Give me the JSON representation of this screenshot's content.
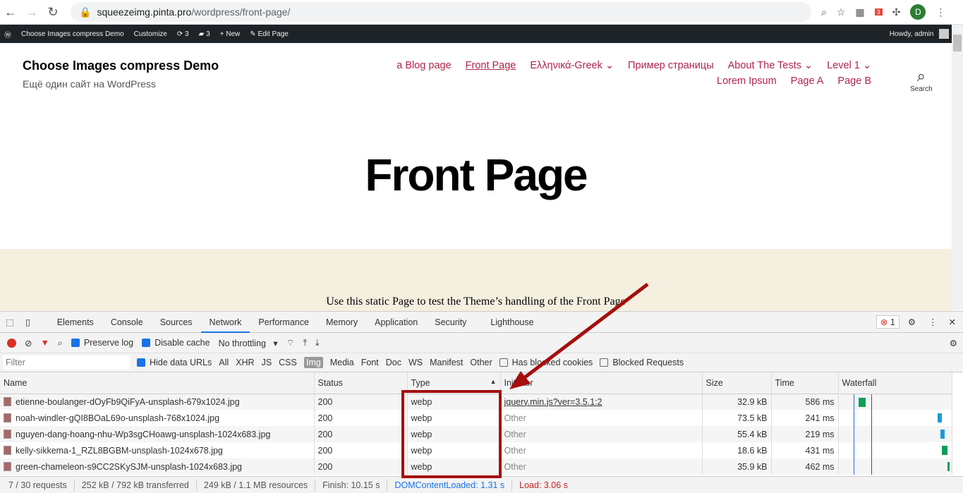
{
  "browser": {
    "url_host": "squeezeimg.pinta.pro",
    "url_path": "/wordpress/front-page/",
    "profile_initial": "D",
    "ext_badge": "3"
  },
  "adminbar": {
    "site": "Choose Images compress Demo",
    "customize": "Customize",
    "updates": "3",
    "comments": "3",
    "new": "New",
    "edit": "Edit Page",
    "howdy": "Howdy, admin"
  },
  "site": {
    "title": "Choose Images compress Demo",
    "tagline": "Ещё один сайт на WordPress",
    "nav": [
      "a Blog page",
      "Front Page",
      "Ελληνικά-Greek ⌄",
      "Пример страницы",
      "About The Tests ⌄",
      "Level 1 ⌄",
      "Lorem Ipsum",
      "Page A",
      "Page B"
    ],
    "search": "Search",
    "heading": "Front Page",
    "intro": "Use this static Page to test the Theme’s handling of the Front Page"
  },
  "devtools": {
    "tabs": [
      "Elements",
      "Console",
      "Sources",
      "Network",
      "Performance",
      "Memory",
      "Application",
      "Security",
      "Lighthouse"
    ],
    "active_tab": "Network",
    "errors": "1",
    "toolbar": {
      "preserve_log": "Preserve log",
      "disable_cache": "Disable cache",
      "throttling": "No throttling"
    },
    "filterbar": {
      "placeholder": "Filter",
      "hide_data_urls": "Hide data URLs",
      "types": [
        "All",
        "XHR",
        "JS",
        "CSS",
        "Img",
        "Media",
        "Font",
        "Doc",
        "WS",
        "Manifest",
        "Other"
      ],
      "selected": "Img",
      "blocked_cookies": "Has blocked cookies",
      "blocked_requests": "Blocked Requests"
    },
    "columns": [
      "Name",
      "Status",
      "Type",
      "Initiator",
      "Size",
      "Time",
      "Waterfall"
    ],
    "rows": [
      {
        "name": "etienne-boulanger-dOyFb9QiFyA-unsplash-679x1024.jpg",
        "status": "200",
        "type": "webp",
        "initiator": "jquery.min.js?ver=3.5.1:2",
        "size": "32.9 kB",
        "time": "586 ms"
      },
      {
        "name": "noah-windler-gQI8BOaL69o-unsplash-768x1024.jpg",
        "status": "200",
        "type": "webp",
        "initiator": "Other",
        "size": "73.5 kB",
        "time": "241 ms"
      },
      {
        "name": "nguyen-dang-hoang-nhu-Wp3sgCHoawg-unsplash-1024x683.jpg",
        "status": "200",
        "type": "webp",
        "initiator": "Other",
        "size": "55.4 kB",
        "time": "219 ms"
      },
      {
        "name": "kelly-sikkema-1_RZL8BGBM-unsplash-1024x678.jpg",
        "status": "200",
        "type": "webp",
        "initiator": "Other",
        "size": "18.6 kB",
        "time": "431 ms"
      },
      {
        "name": "green-chameleon-s9CC2SKySJM-unsplash-1024x683.jpg",
        "status": "200",
        "type": "webp",
        "initiator": "Other",
        "size": "35.9 kB",
        "time": "462 ms"
      }
    ],
    "status": {
      "requests": "7 / 30 requests",
      "transferred": "252 kB / 792 kB transferred",
      "resources": "249 kB / 1.1 MB resources",
      "finish": "Finish: 10.15 s",
      "dcl": "DOMContentLoaded: 1.31 s",
      "load": "Load: 3.06 s"
    }
  },
  "colors": {
    "highlight": "#a50e0e",
    "nav": "#b0244a",
    "dcl": "#1a73e8",
    "load": "#c5221f"
  }
}
